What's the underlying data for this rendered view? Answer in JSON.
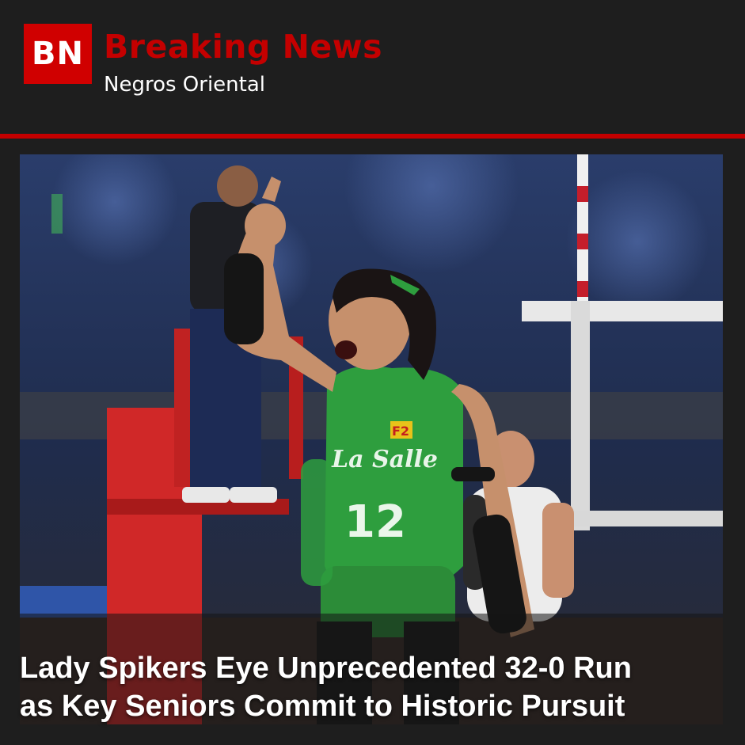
{
  "header": {
    "logo_text": "BN",
    "title": "Breaking News",
    "subtitle": "Negros Oriental"
  },
  "article": {
    "headline_line1": "Lady Spikers Eye Unprecedented 32-0 Run",
    "headline_line2": "as Key Seniors Commit to Historic Pursuit",
    "photo": {
      "jersey_team": "La Salle",
      "jersey_number": "12",
      "sponsor_badge": "F2"
    }
  },
  "colors": {
    "brand_red": "#c40000",
    "logo_red": "#d00000",
    "background": "#1e1e1e",
    "jersey_green": "#2e9e3e"
  }
}
